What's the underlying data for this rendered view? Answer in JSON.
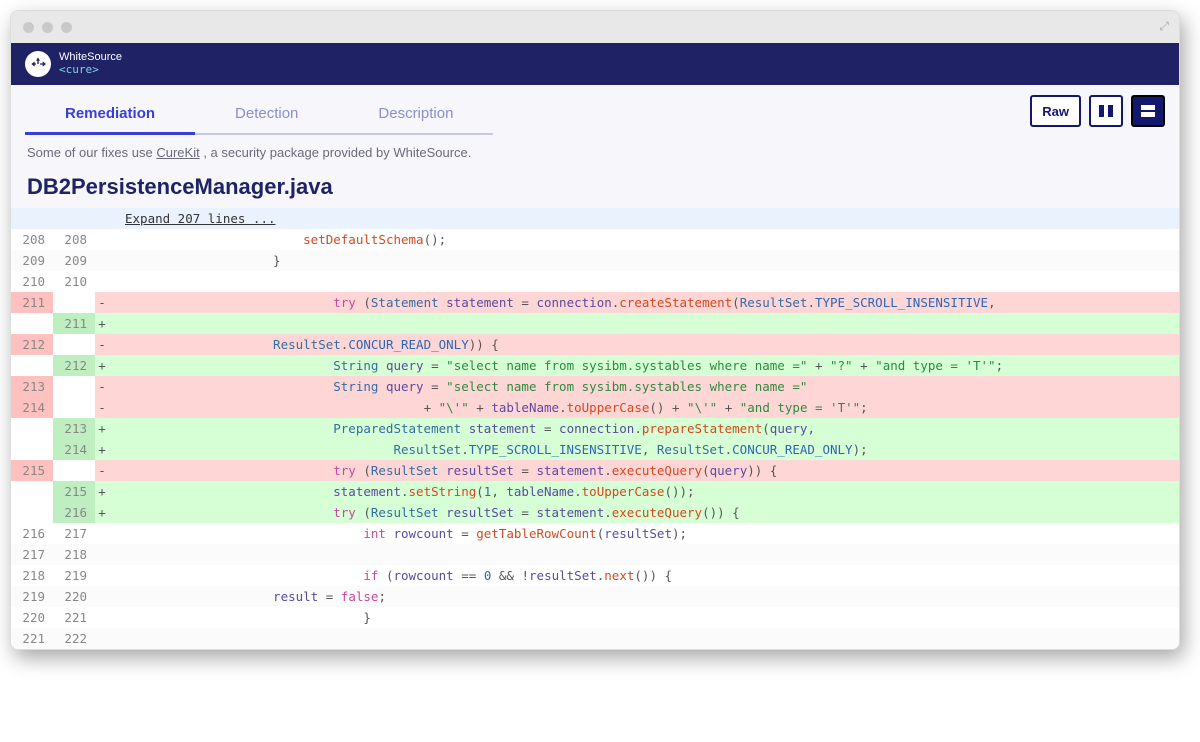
{
  "brand": {
    "name": "WhiteSource",
    "sub": "<cure>"
  },
  "tabs": {
    "remediation": "Remediation",
    "detection": "Detection",
    "description": "Description"
  },
  "buttons": {
    "raw": "Raw"
  },
  "note": {
    "prefix": "Some of our fixes use ",
    "link": "CureKit",
    "suffix": " , a security package provided by WhiteSource."
  },
  "file": "DB2PersistenceManager.java",
  "expand": "Expand 207 lines ...",
  "lines": [
    {
      "type": "context",
      "l": "208",
      "r": "208",
      "html": "                         <span class='tk-fn'>setDefaultSchema</span><span class='tk-pun'>();</span>"
    },
    {
      "type": "context",
      "l": "209",
      "r": "209",
      "html": "                     <span class='tk-pun'>}</span>"
    },
    {
      "type": "context",
      "l": "210",
      "r": "210",
      "html": ""
    },
    {
      "type": "removed",
      "l": "211",
      "r": "",
      "html": "                             <span class='tk-kw'>try</span> <span class='tk-pun'>(</span><span class='tk-type'>Statement</span> <span class='tk-id'>statement</span> <span class='tk-pun'>=</span> <span class='tk-id'>connection</span><span class='tk-pun'>.</span><span class='tk-fn'>createStatement</span><span class='tk-pun'>(</span><span class='tk-type'>ResultSet</span><span class='tk-pun'>.</span><span class='tk-const'>TYPE_SCROLL_INSENSITIVE</span><span class='tk-pun'>,</span>"
    },
    {
      "type": "added",
      "l": "",
      "r": "211",
      "html": ""
    },
    {
      "type": "removed",
      "l": "212",
      "r": "",
      "html": "                     <span class='tk-type'>ResultSet</span><span class='tk-pun'>.</span><span class='tk-const'>CONCUR_READ_ONLY</span><span class='tk-pun'>)) {</span>"
    },
    {
      "type": "added",
      "l": "",
      "r": "212",
      "html": "                             <span class='tk-type'>String</span> <span class='tk-id'>query</span> <span class='tk-pun'>=</span> <span class='tk-str'>\"select name from sysibm.systables where name =\"</span> <span class='tk-pun'>+</span> <span class='tk-str'>\"?\"</span> <span class='tk-pun'>+</span> <span class='tk-str'>\"and type = 'T'\"</span><span class='tk-pun'>;</span>"
    },
    {
      "type": "removed",
      "l": "213",
      "r": "",
      "html": "                             <span class='tk-type'>String</span> <span class='tk-id'>query</span> <span class='tk-pun'>=</span> <span class='tk-str'>\"select name from sysibm.systables where name =\"</span>"
    },
    {
      "type": "removed",
      "l": "214",
      "r": "",
      "html": "                                         <span class='tk-pun'>+</span> <span class='tk-str'>\"\\'\"</span> <span class='tk-pun'>+</span> <span class='tk-id'>tableName</span><span class='tk-pun'>.</span><span class='tk-fn'>toUpperCase</span><span class='tk-pun'>()</span> <span class='tk-pun'>+</span> <span class='tk-str'>\"\\'\"</span> <span class='tk-pun'>+</span> <span class='tk-str'>\"and type = 'T'\"</span><span class='tk-pun'>;</span>"
    },
    {
      "type": "added",
      "l": "",
      "r": "213",
      "html": "                             <span class='tk-type'>PreparedStatement</span> <span class='tk-id'>statement</span> <span class='tk-pun'>=</span> <span class='tk-id'>connection</span><span class='tk-pun'>.</span><span class='tk-fn'>prepareStatement</span><span class='tk-pun'>(</span><span class='tk-id'>query</span><span class='tk-pun'>,</span>"
    },
    {
      "type": "added",
      "l": "",
      "r": "214",
      "html": "                                     <span class='tk-type'>ResultSet</span><span class='tk-pun'>.</span><span class='tk-const'>TYPE_SCROLL_INSENSITIVE</span><span class='tk-pun'>,</span> <span class='tk-type'>ResultSet</span><span class='tk-pun'>.</span><span class='tk-const'>CONCUR_READ_ONLY</span><span class='tk-pun'>);</span>"
    },
    {
      "type": "removed",
      "l": "215",
      "r": "",
      "html": "                             <span class='tk-kw'>try</span> <span class='tk-pun'>(</span><span class='tk-type'>ResultSet</span> <span class='tk-id'>resultSet</span> <span class='tk-pun'>=</span> <span class='tk-id'>statement</span><span class='tk-pun'>.</span><span class='tk-fn'>executeQuery</span><span class='tk-pun'>(</span><span class='tk-id'>query</span><span class='tk-pun'>)) {</span>"
    },
    {
      "type": "added",
      "l": "",
      "r": "215",
      "html": "                             <span class='tk-id'>statement</span><span class='tk-pun'>.</span><span class='tk-fn'>setString</span><span class='tk-pun'>(</span><span class='tk-num'>1</span><span class='tk-pun'>,</span> <span class='tk-id'>tableName</span><span class='tk-pun'>.</span><span class='tk-fn'>toUpperCase</span><span class='tk-pun'>());</span>"
    },
    {
      "type": "added",
      "l": "",
      "r": "216",
      "html": "                             <span class='tk-kw'>try</span> <span class='tk-pun'>(</span><span class='tk-type'>ResultSet</span> <span class='tk-id'>resultSet</span> <span class='tk-pun'>=</span> <span class='tk-id'>statement</span><span class='tk-pun'>.</span><span class='tk-fn'>executeQuery</span><span class='tk-pun'>()) {</span>"
    },
    {
      "type": "context",
      "l": "216",
      "r": "217",
      "html": "                                 <span class='tk-kw'>int</span> <span class='tk-id'>rowcount</span> <span class='tk-pun'>=</span> <span class='tk-fn'>getTableRowCount</span><span class='tk-pun'>(</span><span class='tk-id'>resultSet</span><span class='tk-pun'>);</span>"
    },
    {
      "type": "context",
      "l": "217",
      "r": "218",
      "html": ""
    },
    {
      "type": "context",
      "l": "218",
      "r": "219",
      "html": "                                 <span class='tk-kw'>if</span> <span class='tk-pun'>(</span><span class='tk-id'>rowcount</span> <span class='tk-pun'>==</span> <span class='tk-num'>0</span> <span class='tk-pun'>&amp;&amp;</span> <span class='tk-pun'>!</span><span class='tk-id'>resultSet</span><span class='tk-pun'>.</span><span class='tk-fn'>next</span><span class='tk-pun'>()) {</span>"
    },
    {
      "type": "context",
      "l": "219",
      "r": "220",
      "html": "                     <span class='tk-id'>result</span> <span class='tk-pun'>=</span> <span class='tk-kw'>false</span><span class='tk-pun'>;</span>"
    },
    {
      "type": "context",
      "l": "220",
      "r": "221",
      "html": "                                 <span class='tk-pun'>}</span>"
    },
    {
      "type": "context",
      "l": "221",
      "r": "222",
      "html": ""
    }
  ]
}
